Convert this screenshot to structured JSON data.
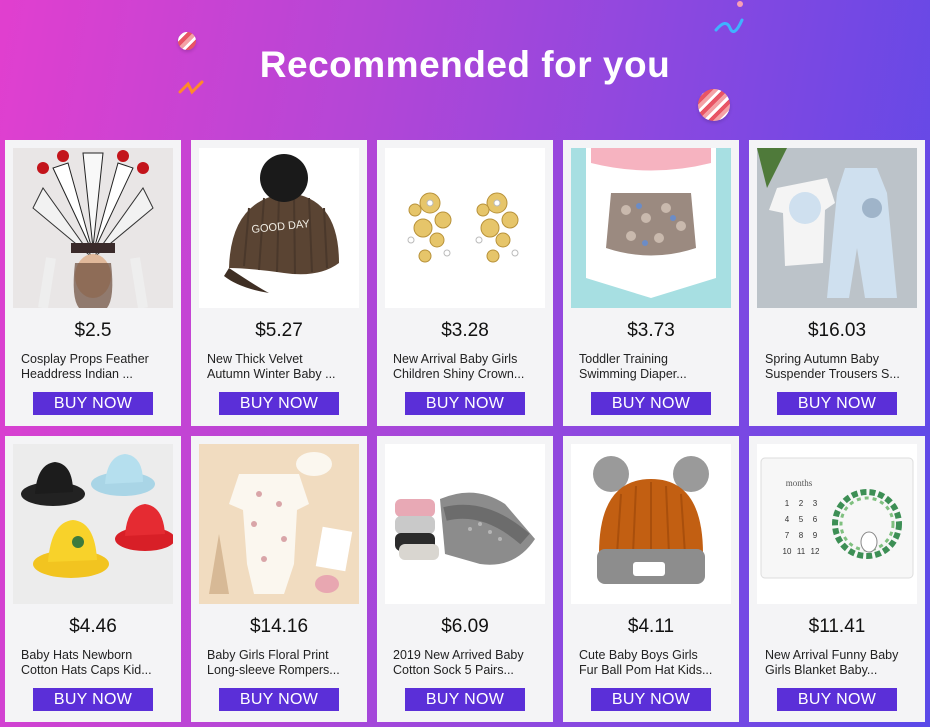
{
  "header": {
    "title": "Recommended for you"
  },
  "colors": {
    "buy_button": "#5b2fd8",
    "card_bg": "#f4f4f6",
    "title_text": "#ffffff"
  },
  "products": [
    {
      "price": "$2.5",
      "name_line1": "Cosplay Props Feather",
      "name_line2": "Headdress Indian ...",
      "button": "BUY NOW",
      "image": "feather-headdress-image"
    },
    {
      "price": "$5.27",
      "name_line1": "New Thick Velvet",
      "name_line2": "Autumn Winter Baby ...",
      "button": "BUY NOW",
      "image": "velvet-cap-image"
    },
    {
      "price": "$3.28",
      "name_line1": "New Arrival Baby Girls",
      "name_line2": "Children Shiny Crown...",
      "button": "BUY NOW",
      "image": "flower-earrings-image"
    },
    {
      "price": "$3.73",
      "name_line1": "Toddler Training",
      "name_line2": "Swimming Diaper...",
      "button": "BUY NOW",
      "image": "swim-diaper-image"
    },
    {
      "price": "$16.03",
      "name_line1": "Spring Autumn Baby",
      "name_line2": "Suspender Trousers S...",
      "button": "BUY NOW",
      "image": "baby-outfit-image"
    },
    {
      "price": "$4.46",
      "name_line1": "Baby Hats Newborn",
      "name_line2": "Cotton Hats Caps Kid...",
      "button": "BUY NOW",
      "image": "bucket-hats-image"
    },
    {
      "price": "$14.16",
      "name_line1": "Baby Girls Floral Print",
      "name_line2": "Long-sleeve Rompers...",
      "button": "BUY NOW",
      "image": "floral-romper-image"
    },
    {
      "price": "$6.09",
      "name_line1": "2019 New Arrived Baby",
      "name_line2": "Cotton Sock 5 Pairs...",
      "button": "BUY NOW",
      "image": "knee-pads-image"
    },
    {
      "price": "$4.11",
      "name_line1": "Cute Baby Boys Girls",
      "name_line2": "Fur Ball Pom Hat Kids...",
      "button": "BUY NOW",
      "image": "pom-hat-image"
    },
    {
      "price": "$11.41",
      "name_line1": "New Arrival Funny Baby",
      "name_line2": "Girls Blanket Baby...",
      "button": "BUY NOW",
      "image": "milestone-blanket-image"
    }
  ],
  "image_texts": {
    "cap_text": "GOOD DAY",
    "blanket_word": "months",
    "blanket_numbers": [
      "1",
      "2",
      "3",
      "4",
      "5",
      "6",
      "7",
      "8",
      "9",
      "10",
      "11",
      "12"
    ]
  }
}
